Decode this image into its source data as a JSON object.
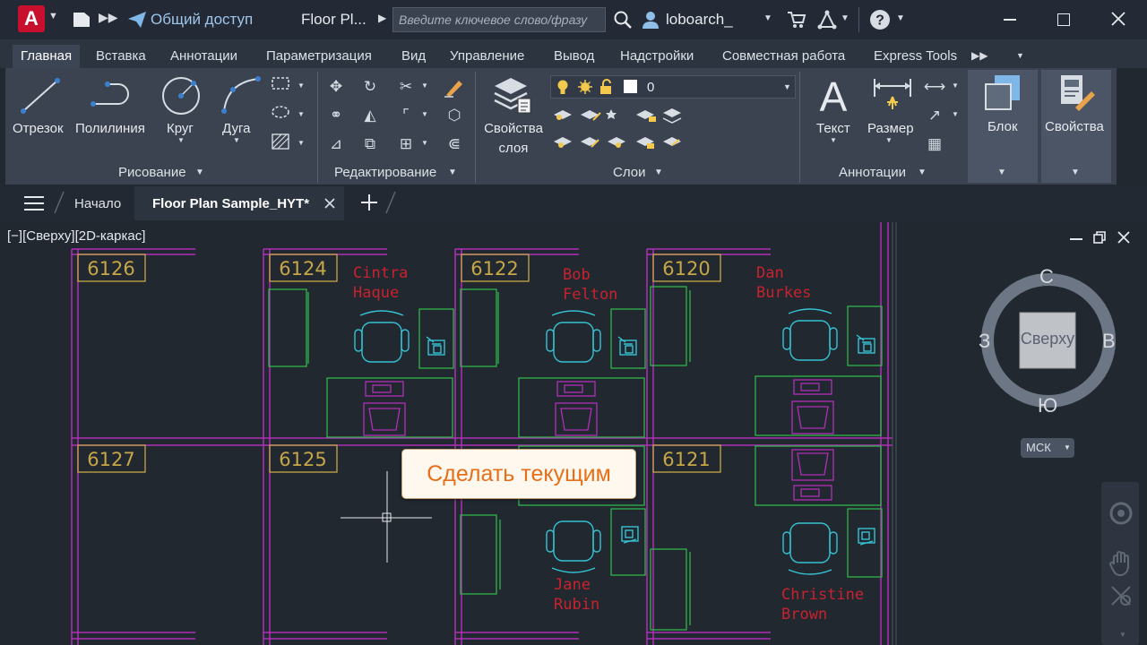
{
  "titlebar": {
    "app_logo": "A",
    "share_label": "Общий доступ",
    "doc_title": "Floor Pl...",
    "search_placeholder": "Введите ключевое слово/фразу",
    "user_name": "loboarch_"
  },
  "ribbon_tabs": [
    "Главная",
    "Вставка",
    "Аннотации",
    "Параметризация",
    "Вид",
    "Управление",
    "Вывод",
    "Надстройки",
    "Совместная работа",
    "Express Tools"
  ],
  "draw_panel": {
    "title": "Рисование",
    "buttons": [
      "Отрезок",
      "Полилиния",
      "Круг",
      "Дуга"
    ]
  },
  "modify_panel": {
    "title": "Редактирование"
  },
  "layers_panel": {
    "title": "Слои",
    "properties_label": "Свойства",
    "properties_label2": "слоя",
    "current_layer": "0"
  },
  "annot_panel": {
    "title": "Аннотации",
    "buttons": [
      "Текст",
      "Размер"
    ]
  },
  "block_panel": {
    "label": "Блок"
  },
  "props_panel": {
    "label": "Свойства"
  },
  "file_tabs": {
    "home": "Начало",
    "active": "Floor Plan Sample_HYT*"
  },
  "viewport": {
    "label": "[−][Сверху][2D-каркас]",
    "rooms": [
      "6126",
      "6124",
      "6122",
      "6120",
      "6127",
      "6125",
      "6121"
    ],
    "people": [
      {
        "first": "Cintra",
        "last": "Haque"
      },
      {
        "first": "Bob",
        "last": "Felton"
      },
      {
        "first": "Dan",
        "last": "Burkes"
      },
      {
        "first": "Jane",
        "last": "Rubin"
      },
      {
        "first": "Christine",
        "last": "Brown"
      }
    ],
    "tooltip": "Сделать текущим"
  },
  "viewcube": {
    "north": "С",
    "south": "Ю",
    "east": "В",
    "west": "З",
    "face": "Сверху",
    "ucs": "МСК"
  },
  "colors": {
    "walls": "#b02fb8",
    "furniture_green": "#2fb648",
    "furniture_cyan": "#36c3d4",
    "room_tags": "#c7a646",
    "names": "#c8222e",
    "tooltip_text": "#e76f1a"
  }
}
